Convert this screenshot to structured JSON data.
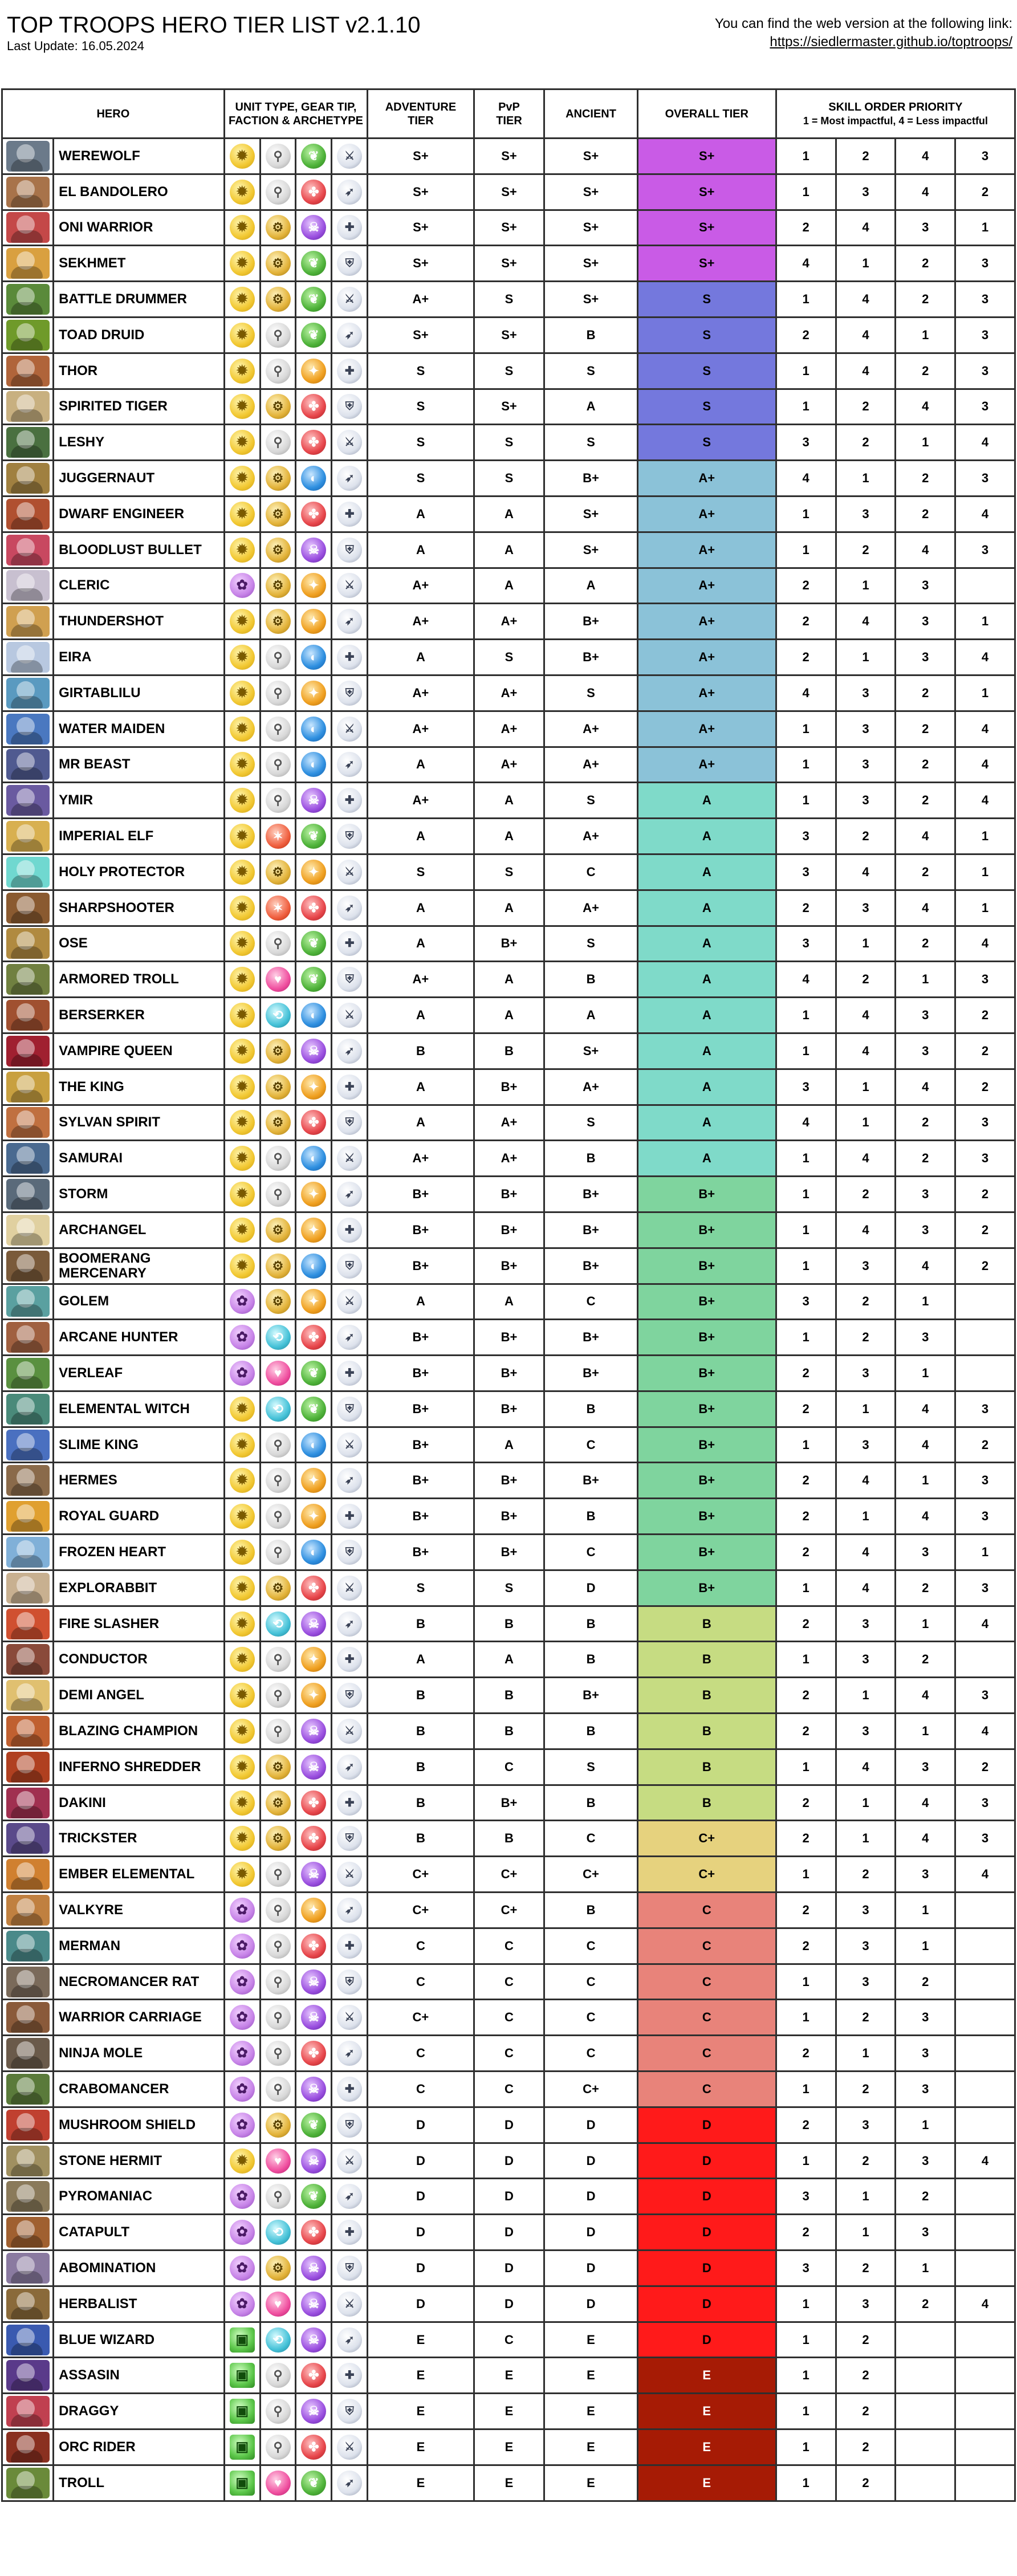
{
  "header": {
    "title": "TOP TROOPS HERO TIER LIST v2.1.10",
    "last_update": "Last Update: 16.05.2024",
    "link_text": "You can find the web version at the following link:",
    "link_url": "https://siedlermaster.github.io/toptroops/"
  },
  "columns": {
    "hero": "HERO",
    "unit_line1": "UNIT TYPE, GEAR TIP,",
    "unit_line2": "FACTION & ARCHETYPE",
    "adventure_line1": "ADVENTURE",
    "adventure_line2": "TIER",
    "pvp_line1": "PvP",
    "pvp_line2": "TIER",
    "ancient": "ANCIENT",
    "overall": "OVERALL TIER",
    "skill_line1": "SKILL ORDER PRIORITY",
    "skill_line2": "1 = Most impactful, 4 = Less impactful"
  },
  "colors": {
    "S+": "#c95be6",
    "S": "#7478dd",
    "A+": "#8bc2d8",
    "A": "#7fdac9",
    "B+": "#7fd49e",
    "B": "#c6dc82",
    "C+": "#e6d27e",
    "C": "#e8837a",
    "D": "#ff1a1a",
    "E": "#a61b05"
  },
  "heroes": [
    {
      "name": "WEREWOLF",
      "type": "gold",
      "gear": "white",
      "faction": "green",
      "adv": "S+",
      "pvp": "S+",
      "anc": "S+",
      "overall": "S+",
      "skills": [
        "1",
        "2",
        "4",
        "3"
      ],
      "pc": "#6b7a8a"
    },
    {
      "name": "EL BANDOLERO",
      "type": "gold",
      "gear": "white",
      "faction": "red",
      "adv": "S+",
      "pvp": "S+",
      "anc": "S+",
      "overall": "S+",
      "skills": [
        "1",
        "3",
        "4",
        "2"
      ],
      "pc": "#a8734a"
    },
    {
      "name": "ONI WARRIOR",
      "type": "gold",
      "gear": "gold",
      "faction": "purple",
      "adv": "S+",
      "pvp": "S+",
      "anc": "S+",
      "overall": "S+",
      "skills": [
        "2",
        "4",
        "3",
        "1"
      ],
      "pc": "#c44848"
    },
    {
      "name": "SEKHMET",
      "type": "gold",
      "gear": "gold",
      "faction": "green",
      "adv": "S+",
      "pvp": "S+",
      "anc": "S+",
      "overall": "S+",
      "skills": [
        "4",
        "1",
        "2",
        "3"
      ],
      "pc": "#d9a040"
    },
    {
      "name": "BATTLE DRUMMER",
      "type": "gold",
      "gear": "gold",
      "faction": "green",
      "adv": "A+",
      "pvp": "S",
      "anc": "S+",
      "overall": "S",
      "skills": [
        "1",
        "4",
        "2",
        "3"
      ],
      "pc": "#5a8a3a"
    },
    {
      "name": "TOAD DRUID",
      "type": "gold",
      "gear": "white",
      "faction": "green",
      "adv": "S+",
      "pvp": "S+",
      "anc": "B",
      "overall": "S",
      "skills": [
        "2",
        "4",
        "1",
        "3"
      ],
      "pc": "#6f9a2a"
    },
    {
      "name": "THOR",
      "type": "gold",
      "gear": "white",
      "faction": "yellow",
      "adv": "S",
      "pvp": "S",
      "anc": "S",
      "overall": "S",
      "skills": [
        "1",
        "4",
        "2",
        "3"
      ],
      "pc": "#b0643a"
    },
    {
      "name": "SPIRITED TIGER",
      "type": "gold",
      "gear": "gold",
      "faction": "red",
      "adv": "S",
      "pvp": "S+",
      "anc": "A",
      "overall": "S",
      "skills": [
        "1",
        "2",
        "4",
        "3"
      ],
      "pc": "#c8b080"
    },
    {
      "name": "LESHY",
      "type": "gold",
      "gear": "white",
      "faction": "red",
      "adv": "S",
      "pvp": "S",
      "anc": "S",
      "overall": "S",
      "skills": [
        "3",
        "2",
        "1",
        "4"
      ],
      "pc": "#4a7040"
    },
    {
      "name": "JUGGERNAUT",
      "type": "gold",
      "gear": "gold",
      "faction": "blue",
      "adv": "S",
      "pvp": "S",
      "anc": "B+",
      "overall": "A+",
      "skills": [
        "4",
        "1",
        "2",
        "3"
      ],
      "pc": "#a08040"
    },
    {
      "name": "DWARF ENGINEER",
      "type": "gold",
      "gear": "gold",
      "faction": "red",
      "adv": "A",
      "pvp": "A",
      "anc": "S+",
      "overall": "A+",
      "skills": [
        "1",
        "3",
        "2",
        "4"
      ],
      "pc": "#b05030"
    },
    {
      "name": "BLOODLUST BULLET",
      "type": "gold",
      "gear": "gold",
      "faction": "purple",
      "adv": "A",
      "pvp": "A",
      "anc": "S+",
      "overall": "A+",
      "skills": [
        "1",
        "2",
        "4",
        "3"
      ],
      "pc": "#c84860"
    },
    {
      "name": "CLERIC",
      "type": "purple",
      "gear": "gold",
      "faction": "yellow",
      "adv": "A+",
      "pvp": "A",
      "anc": "A",
      "overall": "A+",
      "skills": [
        "2",
        "1",
        "3",
        ""
      ],
      "pc": "#c8c0d0"
    },
    {
      "name": "THUNDERSHOT",
      "type": "gold",
      "gear": "gold",
      "faction": "yellow",
      "adv": "A+",
      "pvp": "A+",
      "anc": "B+",
      "overall": "A+",
      "skills": [
        "2",
        "4",
        "3",
        "1"
      ],
      "pc": "#d0a050"
    },
    {
      "name": "EIRA",
      "type": "gold",
      "gear": "white",
      "faction": "blue",
      "adv": "A",
      "pvp": "S",
      "anc": "B+",
      "overall": "A+",
      "skills": [
        "2",
        "1",
        "3",
        "4"
      ],
      "pc": "#b8c8e0"
    },
    {
      "name": "GIRTABLILU",
      "type": "gold",
      "gear": "white",
      "faction": "yellow",
      "adv": "A+",
      "pvp": "A+",
      "anc": "S",
      "overall": "A+",
      "skills": [
        "4",
        "3",
        "2",
        "1"
      ],
      "pc": "#5a9ac0"
    },
    {
      "name": "WATER MAIDEN",
      "type": "gold",
      "gear": "white",
      "faction": "blue",
      "adv": "A+",
      "pvp": "A+",
      "anc": "A+",
      "overall": "A+",
      "skills": [
        "1",
        "3",
        "2",
        "4"
      ],
      "pc": "#4a78c0"
    },
    {
      "name": "MR BEAST",
      "type": "gold",
      "gear": "white",
      "faction": "blue",
      "adv": "A",
      "pvp": "A+",
      "anc": "A+",
      "overall": "A+",
      "skills": [
        "1",
        "3",
        "2",
        "4"
      ],
      "pc": "#505a90"
    },
    {
      "name": "YMIR",
      "type": "gold",
      "gear": "white",
      "faction": "purple",
      "adv": "A+",
      "pvp": "A",
      "anc": "S",
      "overall": "A",
      "skills": [
        "1",
        "3",
        "2",
        "4"
      ],
      "pc": "#6a5aa0"
    },
    {
      "name": "IMPERIAL ELF",
      "type": "gold",
      "gear": "red",
      "faction": "green",
      "adv": "A",
      "pvp": "A",
      "anc": "A+",
      "overall": "A",
      "skills": [
        "3",
        "2",
        "4",
        "1"
      ],
      "pc": "#d8b050"
    },
    {
      "name": "HOLY PROTECTOR",
      "type": "gold",
      "gear": "gold",
      "faction": "yellow",
      "adv": "S",
      "pvp": "S",
      "anc": "C",
      "overall": "A",
      "skills": [
        "3",
        "4",
        "2",
        "1"
      ],
      "pc": "#70d8d0"
    },
    {
      "name": "SHARPSHOOTER",
      "type": "gold",
      "gear": "red",
      "faction": "red",
      "adv": "A",
      "pvp": "A",
      "anc": "A+",
      "overall": "A",
      "skills": [
        "2",
        "3",
        "4",
        "1"
      ],
      "pc": "#8a5a30"
    },
    {
      "name": "OSE",
      "type": "gold",
      "gear": "white",
      "faction": "green",
      "adv": "A",
      "pvp": "B+",
      "anc": "S",
      "overall": "A",
      "skills": [
        "3",
        "1",
        "2",
        "4"
      ],
      "pc": "#b08a40"
    },
    {
      "name": "ARMORED TROLL",
      "type": "gold",
      "gear": "pink",
      "faction": "green",
      "adv": "A+",
      "pvp": "A",
      "anc": "B",
      "overall": "A",
      "skills": [
        "4",
        "2",
        "1",
        "3"
      ],
      "pc": "#708040"
    },
    {
      "name": "BERSERKER",
      "type": "gold",
      "gear": "teal",
      "faction": "blue",
      "adv": "A",
      "pvp": "A",
      "anc": "A",
      "overall": "A",
      "skills": [
        "1",
        "4",
        "3",
        "2"
      ],
      "pc": "#a05030"
    },
    {
      "name": "VAMPIRE QUEEN",
      "type": "gold",
      "gear": "gold",
      "faction": "purple",
      "adv": "B",
      "pvp": "B",
      "anc": "S+",
      "overall": "A",
      "skills": [
        "1",
        "4",
        "3",
        "2"
      ],
      "pc": "#a02030"
    },
    {
      "name": "THE KING",
      "type": "gold",
      "gear": "gold",
      "faction": "yellow",
      "adv": "A",
      "pvp": "B+",
      "anc": "A+",
      "overall": "A",
      "skills": [
        "3",
        "1",
        "4",
        "2"
      ],
      "pc": "#c8a040"
    },
    {
      "name": "SYLVAN SPIRIT",
      "type": "gold",
      "gear": "gold",
      "faction": "red",
      "adv": "A",
      "pvp": "A+",
      "anc": "S",
      "overall": "A",
      "skills": [
        "4",
        "1",
        "2",
        "3"
      ],
      "pc": "#c07040"
    },
    {
      "name": "SAMURAI",
      "type": "gold",
      "gear": "white",
      "faction": "blue",
      "adv": "A+",
      "pvp": "A+",
      "anc": "B",
      "overall": "A",
      "skills": [
        "1",
        "4",
        "2",
        "3"
      ],
      "pc": "#4a6a90"
    },
    {
      "name": "STORM",
      "type": "gold",
      "gear": "white",
      "faction": "yellow",
      "adv": "B+",
      "pvp": "B+",
      "anc": "B+",
      "overall": "B+",
      "skills": [
        "1",
        "2",
        "3",
        "2"
      ],
      "pc": "#5a6a7a"
    },
    {
      "name": "ARCHANGEL",
      "type": "gold",
      "gear": "gold",
      "faction": "yellow",
      "adv": "B+",
      "pvp": "B+",
      "anc": "B+",
      "overall": "B+",
      "skills": [
        "1",
        "4",
        "3",
        "2"
      ],
      "pc": "#e0d0a0"
    },
    {
      "name": "BOOMERANG MERCENARY",
      "type": "gold",
      "gear": "gold",
      "faction": "blue",
      "adv": "B+",
      "pvp": "B+",
      "anc": "B+",
      "overall": "B+",
      "skills": [
        "1",
        "3",
        "4",
        "2"
      ],
      "pc": "#7a5a3a"
    },
    {
      "name": "GOLEM",
      "type": "purple",
      "gear": "gold",
      "faction": "yellow",
      "adv": "A",
      "pvp": "A",
      "anc": "C",
      "overall": "B+",
      "skills": [
        "3",
        "2",
        "1",
        ""
      ],
      "pc": "#5aa0a0"
    },
    {
      "name": "ARCANE HUNTER",
      "type": "purple",
      "gear": "teal",
      "faction": "red",
      "adv": "B+",
      "pvp": "B+",
      "anc": "B+",
      "overall": "B+",
      "skills": [
        "1",
        "2",
        "3",
        ""
      ],
      "pc": "#a06040"
    },
    {
      "name": "VERLEAF",
      "type": "purple",
      "gear": "pink",
      "faction": "green",
      "adv": "B+",
      "pvp": "B+",
      "anc": "B+",
      "overall": "B+",
      "skills": [
        "2",
        "3",
        "1",
        ""
      ],
      "pc": "#5a9040"
    },
    {
      "name": "ELEMENTAL WITCH",
      "type": "gold",
      "gear": "teal",
      "faction": "green",
      "adv": "B+",
      "pvp": "B+",
      "anc": "B",
      "overall": "B+",
      "skills": [
        "2",
        "1",
        "4",
        "3"
      ],
      "pc": "#4a8a7a"
    },
    {
      "name": "SLIME KING",
      "type": "gold",
      "gear": "white",
      "faction": "blue",
      "adv": "B+",
      "pvp": "A",
      "anc": "C",
      "overall": "B+",
      "skills": [
        "1",
        "3",
        "4",
        "2"
      ],
      "pc": "#4a70c0"
    },
    {
      "name": "HERMES",
      "type": "gold",
      "gear": "white",
      "faction": "yellow",
      "adv": "B+",
      "pvp": "B+",
      "anc": "B+",
      "overall": "B+",
      "skills": [
        "2",
        "4",
        "1",
        "3"
      ],
      "pc": "#8a6a4a"
    },
    {
      "name": "ROYAL GUARD",
      "type": "gold",
      "gear": "white",
      "faction": "yellow",
      "adv": "B+",
      "pvp": "B+",
      "anc": "B",
      "overall": "B+",
      "skills": [
        "2",
        "1",
        "4",
        "3"
      ],
      "pc": "#e0a030"
    },
    {
      "name": "FROZEN HEART",
      "type": "gold",
      "gear": "white",
      "faction": "blue",
      "adv": "B+",
      "pvp": "B+",
      "anc": "C",
      "overall": "B+",
      "skills": [
        "2",
        "4",
        "3",
        "1"
      ],
      "pc": "#80b0d8"
    },
    {
      "name": "EXPLORABBIT",
      "type": "gold",
      "gear": "gold",
      "faction": "red",
      "adv": "S",
      "pvp": "S",
      "anc": "D",
      "overall": "B+",
      "skills": [
        "1",
        "4",
        "2",
        "3"
      ],
      "pc": "#c8b090"
    },
    {
      "name": "FIRE SLASHER",
      "type": "gold",
      "gear": "teal",
      "faction": "purple",
      "adv": "B",
      "pvp": "B",
      "anc": "B",
      "overall": "B",
      "skills": [
        "2",
        "3",
        "1",
        "4"
      ],
      "pc": "#d05030"
    },
    {
      "name": "CONDUCTOR",
      "type": "gold",
      "gear": "white",
      "faction": "yellow",
      "adv": "A",
      "pvp": "A",
      "anc": "B",
      "overall": "B",
      "skills": [
        "1",
        "3",
        "2",
        ""
      ],
      "pc": "#8a4a3a"
    },
    {
      "name": "DEMI ANGEL",
      "type": "gold",
      "gear": "white",
      "faction": "yellow",
      "adv": "B",
      "pvp": "B",
      "anc": "B+",
      "overall": "B",
      "skills": [
        "2",
        "1",
        "4",
        "3"
      ],
      "pc": "#e0c070"
    },
    {
      "name": "BLAZING CHAMPION",
      "type": "gold",
      "gear": "white",
      "faction": "purple",
      "adv": "B",
      "pvp": "B",
      "anc": "B",
      "overall": "B",
      "skills": [
        "2",
        "3",
        "1",
        "4"
      ],
      "pc": "#c06030"
    },
    {
      "name": "INFERNO SHREDDER",
      "type": "gold",
      "gear": "gold",
      "faction": "purple",
      "adv": "B",
      "pvp": "C",
      "anc": "S",
      "overall": "B",
      "skills": [
        "1",
        "4",
        "3",
        "2"
      ],
      "pc": "#b04020"
    },
    {
      "name": "DAKINI",
      "type": "gold",
      "gear": "gold",
      "faction": "red",
      "adv": "B",
      "pvp": "B+",
      "anc": "B",
      "overall": "B",
      "skills": [
        "2",
        "1",
        "4",
        "3"
      ],
      "pc": "#a03050"
    },
    {
      "name": "TRICKSTER",
      "type": "gold",
      "gear": "gold",
      "faction": "red",
      "adv": "B",
      "pvp": "B",
      "anc": "C",
      "overall": "C+",
      "skills": [
        "2",
        "1",
        "4",
        "3"
      ],
      "pc": "#5a4a8a"
    },
    {
      "name": "EMBER ELEMENTAL",
      "type": "gold",
      "gear": "white",
      "faction": "purple",
      "adv": "C+",
      "pvp": "C+",
      "anc": "C+",
      "overall": "C+",
      "skills": [
        "1",
        "2",
        "3",
        "4"
      ],
      "pc": "#d08030"
    },
    {
      "name": "VALKYRE",
      "type": "purple",
      "gear": "white",
      "faction": "yellow",
      "adv": "C+",
      "pvp": "C+",
      "anc": "B",
      "overall": "C",
      "skills": [
        "2",
        "3",
        "1",
        ""
      ],
      "pc": "#c08040"
    },
    {
      "name": "MERMAN",
      "type": "purple",
      "gear": "white",
      "faction": "red",
      "adv": "C",
      "pvp": "C",
      "anc": "C",
      "overall": "C",
      "skills": [
        "2",
        "3",
        "1",
        ""
      ],
      "pc": "#4a8a8a"
    },
    {
      "name": "NECROMANCER RAT",
      "type": "purple",
      "gear": "white",
      "faction": "purple",
      "adv": "C",
      "pvp": "C",
      "anc": "C",
      "overall": "C",
      "skills": [
        "1",
        "3",
        "2",
        ""
      ],
      "pc": "#7a6a5a"
    },
    {
      "name": "WARRIOR CARRIAGE",
      "type": "purple",
      "gear": "white",
      "faction": "purple",
      "adv": "C+",
      "pvp": "C",
      "anc": "C",
      "overall": "C",
      "skills": [
        "1",
        "2",
        "3",
        ""
      ],
      "pc": "#8a5a3a"
    },
    {
      "name": "NINJA MOLE",
      "type": "purple",
      "gear": "white",
      "faction": "red",
      "adv": "C",
      "pvp": "C",
      "anc": "C",
      "overall": "C",
      "skills": [
        "2",
        "1",
        "3",
        ""
      ],
      "pc": "#6a5a4a"
    },
    {
      "name": "CRABOMANCER",
      "type": "purple",
      "gear": "white",
      "faction": "purple",
      "adv": "C",
      "pvp": "C",
      "anc": "C+",
      "overall": "C",
      "skills": [
        "1",
        "2",
        "3",
        ""
      ],
      "pc": "#5a7a3a"
    },
    {
      "name": "MUSHROOM SHIELD",
      "type": "purple",
      "gear": "gold",
      "faction": "green",
      "adv": "D",
      "pvp": "D",
      "anc": "D",
      "overall": "D",
      "skills": [
        "2",
        "3",
        "1",
        ""
      ],
      "pc": "#c04030"
    },
    {
      "name": "STONE HERMIT",
      "type": "gold",
      "gear": "pink",
      "faction": "purple",
      "adv": "D",
      "pvp": "D",
      "anc": "D",
      "overall": "D",
      "skills": [
        "1",
        "2",
        "3",
        "4"
      ],
      "pc": "#a09060"
    },
    {
      "name": "PYROMANIAC",
      "type": "purple",
      "gear": "white",
      "faction": "green",
      "adv": "D",
      "pvp": "D",
      "anc": "D",
      "overall": "D",
      "skills": [
        "3",
        "1",
        "2",
        ""
      ],
      "pc": "#8a7a5a"
    },
    {
      "name": "CATAPULT",
      "type": "purple",
      "gear": "teal",
      "faction": "red",
      "adv": "D",
      "pvp": "D",
      "anc": "D",
      "overall": "D",
      "skills": [
        "2",
        "1",
        "3",
        ""
      ],
      "pc": "#a06030"
    },
    {
      "name": "ABOMINATION",
      "type": "purple",
      "gear": "gold",
      "faction": "purple",
      "adv": "D",
      "pvp": "D",
      "anc": "D",
      "overall": "D",
      "skills": [
        "3",
        "2",
        "1",
        ""
      ],
      "pc": "#8a7aa0"
    },
    {
      "name": "HERBALIST",
      "type": "purple",
      "gear": "pink",
      "faction": "purple",
      "adv": "D",
      "pvp": "D",
      "anc": "D",
      "overall": "D",
      "skills": [
        "1",
        "3",
        "2",
        "4"
      ],
      "pc": "#8a6a3a"
    },
    {
      "name": "BLUE WIZARD",
      "type": "green",
      "gear": "teal",
      "faction": "purple",
      "adv": "E",
      "pvp": "C",
      "anc": "E",
      "overall": "D",
      "skills": [
        "1",
        "2",
        "",
        ""
      ],
      "pc": "#3a5ab0"
    },
    {
      "name": "ASSASIN",
      "type": "green",
      "gear": "white",
      "faction": "red",
      "adv": "E",
      "pvp": "E",
      "anc": "E",
      "overall": "E",
      "skills": [
        "1",
        "2",
        "",
        ""
      ],
      "pc": "#5a3a8a"
    },
    {
      "name": "DRAGGY",
      "type": "green",
      "gear": "white",
      "faction": "purple",
      "adv": "E",
      "pvp": "E",
      "anc": "E",
      "overall": "E",
      "skills": [
        "1",
        "2",
        "",
        ""
      ],
      "pc": "#c04050"
    },
    {
      "name": "ORC RIDER",
      "type": "green",
      "gear": "white",
      "faction": "red",
      "adv": "E",
      "pvp": "E",
      "anc": "E",
      "overall": "E",
      "skills": [
        "1",
        "2",
        "",
        ""
      ],
      "pc": "#8a3020"
    },
    {
      "name": "TROLL",
      "type": "green",
      "gear": "pink",
      "faction": "green",
      "adv": "E",
      "pvp": "E",
      "anc": "E",
      "overall": "E",
      "skills": [
        "1",
        "2",
        "",
        ""
      ],
      "pc": "#6a8a3a"
    }
  ]
}
